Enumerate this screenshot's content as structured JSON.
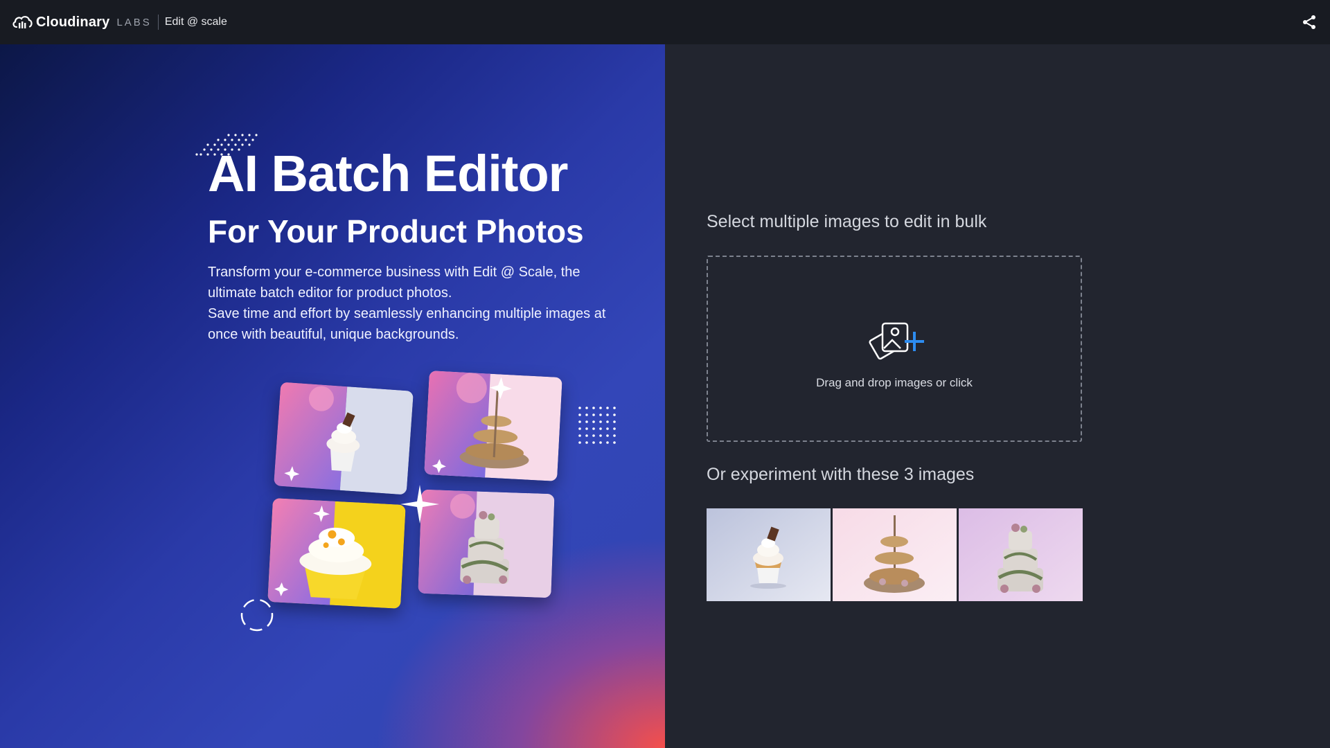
{
  "header": {
    "brand_name": "Cloudinary",
    "brand_suffix": "LABS",
    "app_name": "Edit @ scale",
    "share_icon": "share-icon"
  },
  "hero": {
    "title": "AI Batch Editor",
    "subtitle": "For Your Product Photos",
    "description_1": "Transform your e-commerce business with Edit @ Scale, the ultimate batch editor for product photos.",
    "description_2": "Save time and effort by seamlessly enhancing multiple images at once with beautiful, unique backgrounds.",
    "collage": [
      "cupcake",
      "macarons-stand",
      "yellow-cupcake",
      "floral-cake"
    ]
  },
  "upload": {
    "heading": "Select multiple images to edit in bulk",
    "dropzone_text": "Drag and drop images or click",
    "icon": "add-images-icon"
  },
  "samples": {
    "heading": "Or experiment with these 3 images",
    "items": [
      "cupcake",
      "macarons-stand",
      "floral-cake"
    ]
  },
  "colors": {
    "topbar": "#181b22",
    "panel": "#22252f",
    "accent": "#2d8cf0"
  }
}
